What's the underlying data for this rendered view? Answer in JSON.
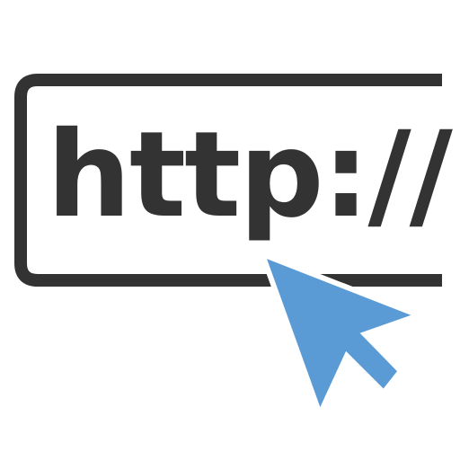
{
  "url_bar": {
    "text": "http://"
  },
  "icons": {
    "cursor": "mouse-pointer-icon",
    "frame": "address-bar-frame"
  },
  "colors": {
    "frame": "#333333",
    "text": "#333333",
    "cursor": "#5b9bd5",
    "background": "#ffffff"
  }
}
